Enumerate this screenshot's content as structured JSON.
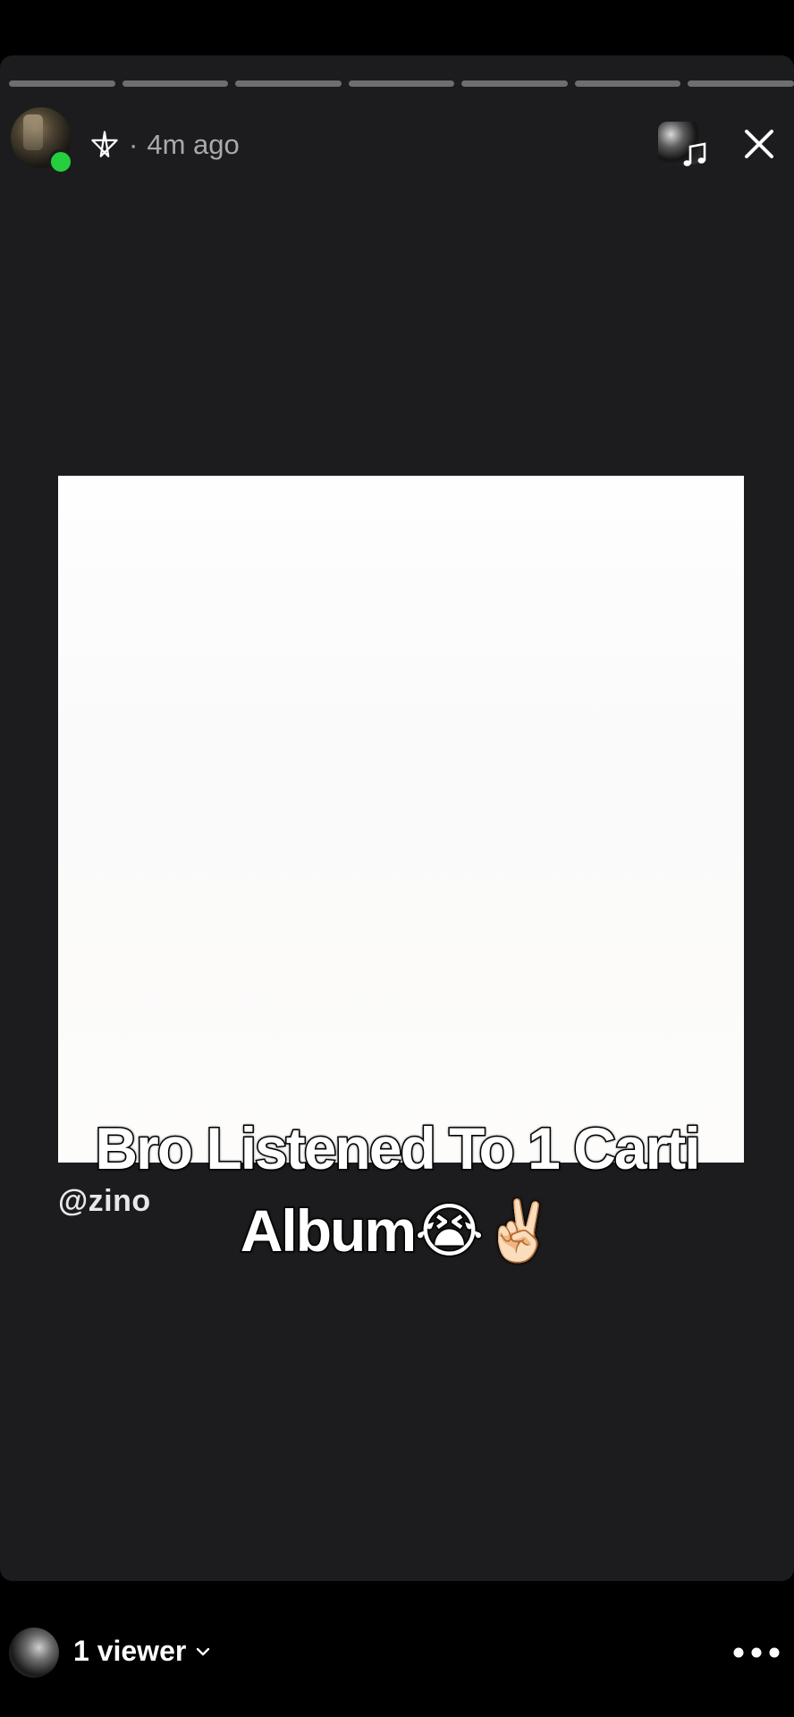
{
  "header": {
    "separator": "·",
    "timestamp": "4m ago",
    "progress_segments": 7,
    "icons": {
      "user_glyph": "pentagram-icon",
      "music": "music-note-icon",
      "close": "close-icon"
    }
  },
  "story": {
    "mention": "@zino",
    "caption_line1": "Bro Listened To 1 Carti",
    "caption_line2": "Album😭✌🏻"
  },
  "footer": {
    "viewers_label": "1 viewer",
    "icons": {
      "viewers_toggle": "chevron-down-icon",
      "more": "more-icon"
    }
  },
  "colors": {
    "page_background": "#000000",
    "story_background": "#1c1c1f",
    "progress_track": "#6e6e72",
    "online_indicator": "#24d03d",
    "media_background": "#fefefe",
    "meta_text": "#a9a9ad"
  }
}
